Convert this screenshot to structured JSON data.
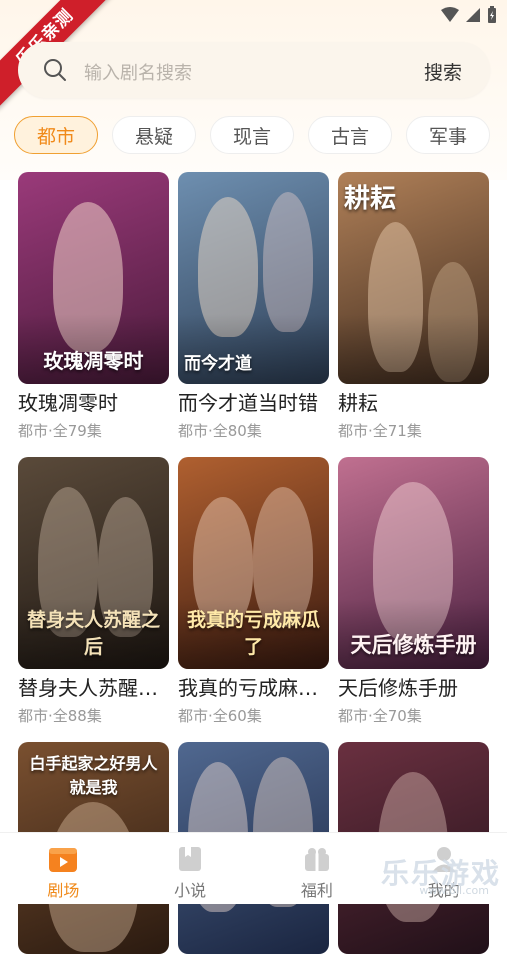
{
  "ribbon": {
    "text": "乐乐亲测"
  },
  "search": {
    "placeholder": "输入剧名搜索",
    "button_label": "搜索"
  },
  "tabs": [
    {
      "label": "都市",
      "active": true
    },
    {
      "label": "悬疑",
      "active": false
    },
    {
      "label": "现言",
      "active": false
    },
    {
      "label": "古言",
      "active": false
    },
    {
      "label": "军事",
      "active": false
    }
  ],
  "cards": [
    {
      "title": "玫瑰凋零时",
      "meta": "都市·全79集",
      "poster_caption": "玫瑰凋零时",
      "colors": [
        "#9a3a7a",
        "#4a1a3a"
      ]
    },
    {
      "title": "而今才道当时错",
      "meta": "都市·全80集",
      "poster_caption": "而今才道",
      "colors": [
        "#6e8fb0",
        "#2d3e55"
      ]
    },
    {
      "title": "耕耘",
      "meta": "都市·全71集",
      "poster_caption": "耕耘",
      "colors": [
        "#b08058",
        "#3f2b1e"
      ]
    },
    {
      "title": "替身夫人苏醒之后",
      "meta": "都市·全88集",
      "poster_caption": "替身夫人苏醒之后",
      "colors": [
        "#5a4a3a",
        "#1e1712"
      ]
    },
    {
      "title": "我真的亏成麻瓜了",
      "meta": "都市·全60集",
      "poster_caption": "我真的亏成麻瓜了",
      "colors": [
        "#b06030",
        "#3a1a10"
      ]
    },
    {
      "title": "天后修炼手册",
      "meta": "都市·全70集",
      "poster_caption": "天后修炼手册",
      "colors": [
        "#c07090",
        "#4a2040"
      ]
    },
    {
      "title": "",
      "meta": "",
      "poster_caption": "白手起家之好男人就是我",
      "colors": [
        "#7a5030",
        "#2a1a10"
      ]
    },
    {
      "title": "",
      "meta": "",
      "poster_caption": "",
      "colors": [
        "#506890",
        "#1a2540"
      ]
    },
    {
      "title": "",
      "meta": "",
      "poster_caption": "",
      "colors": [
        "#6a3040",
        "#201018"
      ]
    }
  ],
  "nav": [
    {
      "label": "剧场",
      "icon": "theater-icon",
      "active": true
    },
    {
      "label": "小说",
      "icon": "book-icon",
      "active": false
    },
    {
      "label": "福利",
      "icon": "gift-icon",
      "active": false
    },
    {
      "label": "我的",
      "icon": "user-icon",
      "active": false
    }
  ],
  "watermark": {
    "text": "乐乐游戏",
    "sub": "www.6ll.com"
  },
  "colors": {
    "accent": "#f08a1a",
    "ribbon": "#cf1f2a"
  }
}
